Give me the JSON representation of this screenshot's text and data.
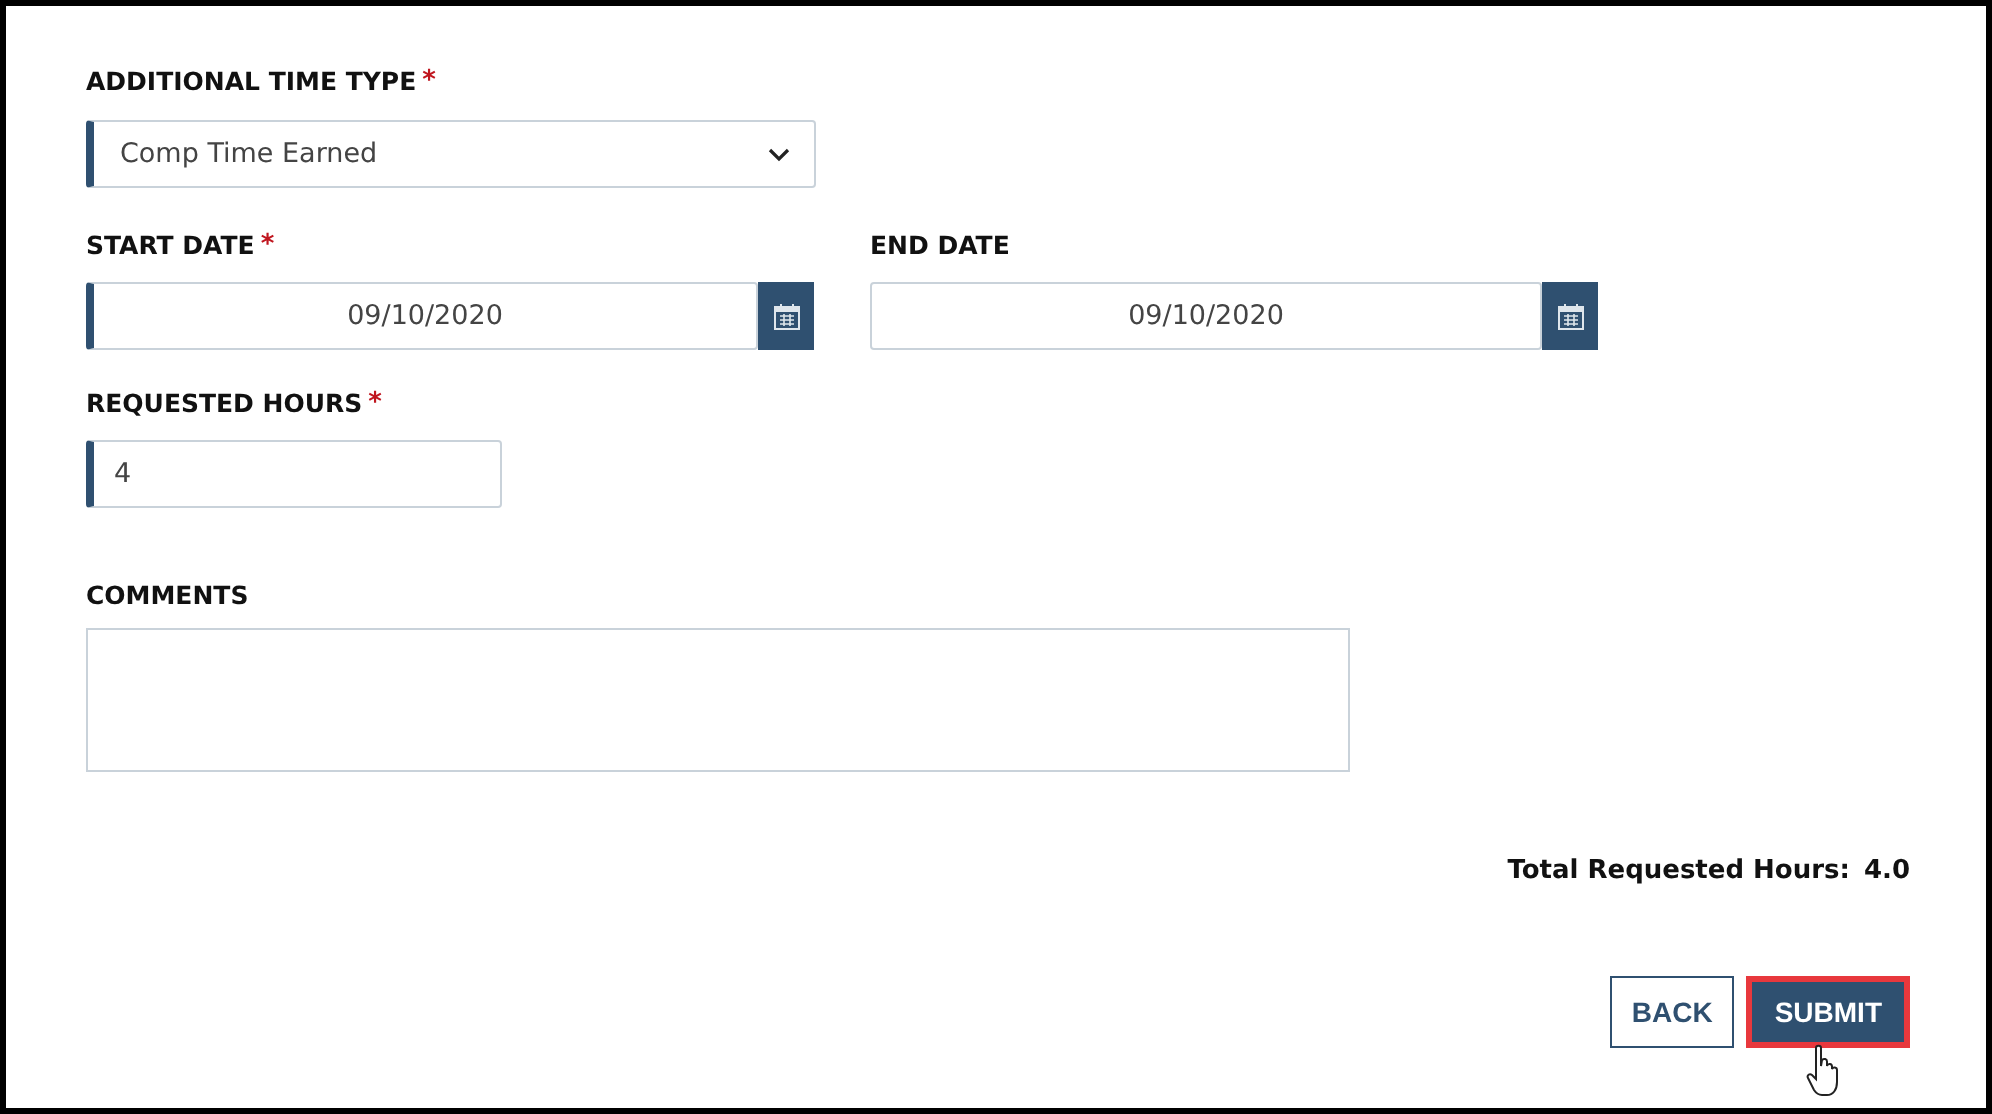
{
  "time_type": {
    "label": "ADDITIONAL TIME TYPE",
    "required_mark": "*",
    "required": true,
    "value": "Comp Time Earned"
  },
  "dates": [
    {
      "label": "START DATE",
      "required_mark": "*",
      "required": true,
      "value": "09/10/2020"
    },
    {
      "label": "END DATE",
      "required": false,
      "value": "09/10/2020"
    }
  ],
  "requested_hours": {
    "label": "REQUESTED HOURS",
    "required_mark": "*",
    "required": true,
    "value": "4"
  },
  "comments": {
    "label": "COMMENTS"
  },
  "total": {
    "label": "Total Requested Hours:",
    "value": "4.0"
  },
  "buttons": [
    {
      "label": "BACK",
      "kind": "secondary",
      "focused": false
    },
    {
      "label": "SUBMIT",
      "kind": "primary",
      "focused": true
    }
  ]
}
